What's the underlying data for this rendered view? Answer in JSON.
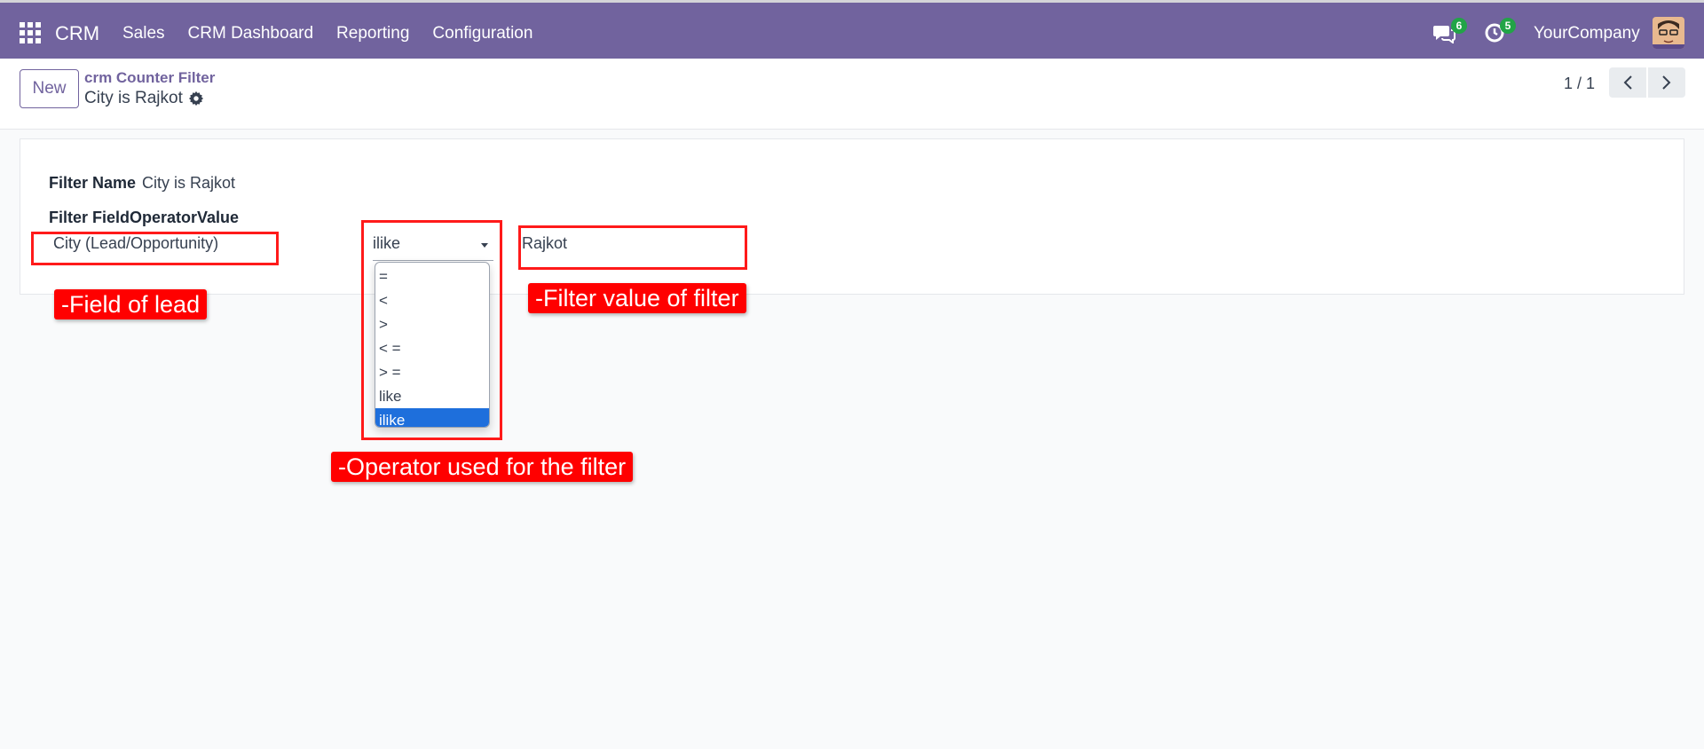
{
  "topbar": {
    "brand": "CRM",
    "menu": [
      "Sales",
      "CRM Dashboard",
      "Reporting",
      "Configuration"
    ],
    "messages_count": "6",
    "activities_count": "5",
    "company": "YourCompany",
    "color": "#71639e"
  },
  "control": {
    "new_label": "New",
    "breadcrumb_parent": "crm Counter Filter",
    "breadcrumb_current": "City is Rajkot",
    "pager": "1 / 1"
  },
  "form": {
    "filter_name_label": "Filter Name",
    "filter_name_value": "City is Rajkot",
    "field_header": "Filter FieldOperatorValue",
    "field_value": "City (Lead/Opportunity)",
    "operator_value": "ilike",
    "operator_options": [
      "=",
      "<",
      ">",
      "< =",
      "> =",
      "like",
      "ilike"
    ],
    "operator_selected_index": 6,
    "filter_value": "Rajkot"
  },
  "annotations": {
    "field": "-Field of lead",
    "value": "-Filter value of filter",
    "operator": "-Operator used for the filter"
  }
}
